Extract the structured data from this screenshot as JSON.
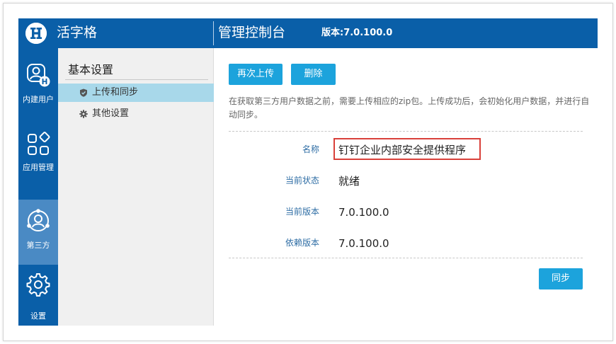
{
  "app": {
    "brand": "活字格",
    "console_title": "管理控制台",
    "version": "版本:7.0.100.0"
  },
  "navbar": {
    "items": [
      {
        "label": "内建用户",
        "icon": "user-h-icon",
        "active": false
      },
      {
        "label": "应用管理",
        "icon": "apps-grid-icon",
        "active": false
      },
      {
        "label": "第三方",
        "icon": "third-party-icon",
        "active": true
      },
      {
        "label": "设置",
        "icon": "gear-icon",
        "active": false
      }
    ]
  },
  "subnav": {
    "title": "基本设置",
    "items": [
      {
        "label": "上传和同步",
        "icon": "shield-icon",
        "active": true
      },
      {
        "label": "其他设置",
        "icon": "cog-icon",
        "active": false
      }
    ]
  },
  "main": {
    "reupload_label": "再次上传",
    "delete_label": "删除",
    "description": "在获取第三方用户数据之前，需要上传相应的zip包。上传成功后，会初始化用户数据，并进行自动同步。",
    "fields": [
      {
        "label": "名称",
        "value": "钉钉企业内部安全提供程序"
      },
      {
        "label": "当前状态",
        "value": "就绪"
      },
      {
        "label": "当前版本",
        "value": "7.0.100.0"
      },
      {
        "label": "依赖版本",
        "value": "7.0.100.0"
      }
    ],
    "sync_label": "同步"
  },
  "colors": {
    "brand_blue": "#0a5fa8",
    "active_nav": "#4a8ac4",
    "button": "#1ca3dc",
    "subnav_active": "#a8d8ea",
    "highlight": "#d9403a"
  }
}
